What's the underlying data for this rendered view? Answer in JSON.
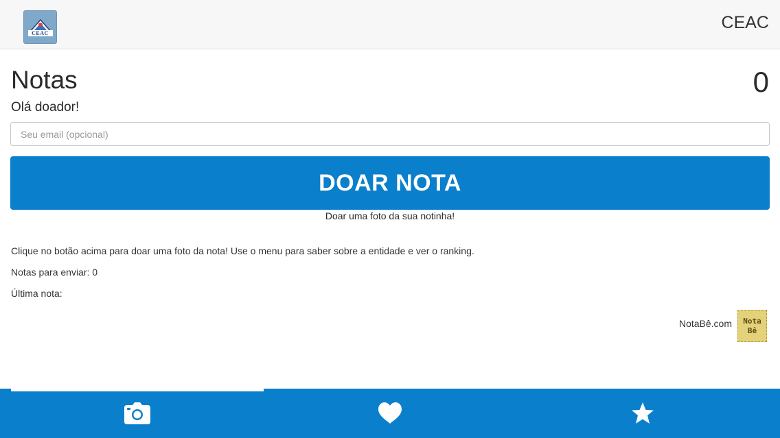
{
  "header": {
    "logo_text": "CEAC",
    "brand": "CEAC"
  },
  "main": {
    "title": "Notas",
    "counter": "0",
    "greeting": "Olá doador!",
    "email_placeholder": "Seu email (opcional)",
    "donate_button": "DOAR NOTA",
    "donate_hint": "Doar uma foto da sua notinha!",
    "instructions": "Clique no botão acima para doar uma foto da nota! Use o menu para saber sobre a entidade e ver o ranking.",
    "pending_label": "Notas para enviar: 0",
    "last_note_label": "Última nota:"
  },
  "footer": {
    "link_text": "NotaBê.com",
    "logo_line1": "Nota",
    "logo_line2": "Bê"
  },
  "tabs": [
    {
      "icon": "camera-icon"
    },
    {
      "icon": "heart-icon"
    },
    {
      "icon": "star-icon"
    }
  ],
  "colors": {
    "accent": "#0a7fcc",
    "header_bg": "#f7f7f7"
  }
}
